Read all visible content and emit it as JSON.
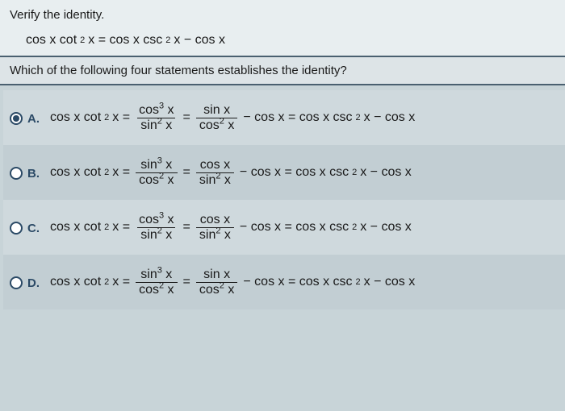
{
  "header": {
    "instruction": "Verify the identity.",
    "identity_lhs_a": "cos x cot",
    "identity_lhs_sup": "2",
    "identity_lhs_b": "x = cos x csc",
    "identity_lhs_sup2": "2",
    "identity_lhs_c": "x − cos x"
  },
  "question": "Which of the following four statements establishes the identity?",
  "options": [
    {
      "label": "A.",
      "selected": true,
      "lhs_a": "cos x cot",
      "lhs_sup": "2",
      "lhs_b": "x =",
      "f1_num_a": "cos",
      "f1_num_sup": "3",
      "f1_num_b": "x",
      "f1_den_a": "sin",
      "f1_den_sup": "2",
      "f1_den_b": "x",
      "eq1": "=",
      "f2_num_a": "sin x",
      "f2_num_sup": "",
      "f2_num_b": "",
      "f2_den_a": "cos",
      "f2_den_sup": "2",
      "f2_den_b": "x",
      "mid": "− cos x = cos x csc",
      "mid_sup": "2",
      "tail": "x − cos x"
    },
    {
      "label": "B.",
      "selected": false,
      "lhs_a": "cos x cot",
      "lhs_sup": "2",
      "lhs_b": "x =",
      "f1_num_a": "sin",
      "f1_num_sup": "3",
      "f1_num_b": "x",
      "f1_den_a": "cos",
      "f1_den_sup": "2",
      "f1_den_b": "x",
      "eq1": "=",
      "f2_num_a": "cos x",
      "f2_num_sup": "",
      "f2_num_b": "",
      "f2_den_a": "sin",
      "f2_den_sup": "2",
      "f2_den_b": "x",
      "mid": "− cos x = cos x csc",
      "mid_sup": "2",
      "tail": "x − cos x"
    },
    {
      "label": "C.",
      "selected": false,
      "lhs_a": "cos x cot",
      "lhs_sup": "2",
      "lhs_b": "x =",
      "f1_num_a": "cos",
      "f1_num_sup": "3",
      "f1_num_b": "x",
      "f1_den_a": "sin",
      "f1_den_sup": "2",
      "f1_den_b": "x",
      "eq1": "=",
      "f2_num_a": "cos x",
      "f2_num_sup": "",
      "f2_num_b": "",
      "f2_den_a": "sin",
      "f2_den_sup": "2",
      "f2_den_b": "x",
      "mid": "− cos x = cos x csc",
      "mid_sup": "2",
      "tail": "x − cos x"
    },
    {
      "label": "D.",
      "selected": false,
      "lhs_a": "cos x cot",
      "lhs_sup": "2",
      "lhs_b": "x =",
      "f1_num_a": "sin",
      "f1_num_sup": "3",
      "f1_num_b": "x",
      "f1_den_a": "cos",
      "f1_den_sup": "2",
      "f1_den_b": "x",
      "eq1": "=",
      "f2_num_a": "sin x",
      "f2_num_sup": "",
      "f2_num_b": "",
      "f2_den_a": "cos",
      "f2_den_sup": "2",
      "f2_den_b": "x",
      "mid": "− cos x = cos x csc",
      "mid_sup": "2",
      "tail": "x − cos x"
    }
  ]
}
